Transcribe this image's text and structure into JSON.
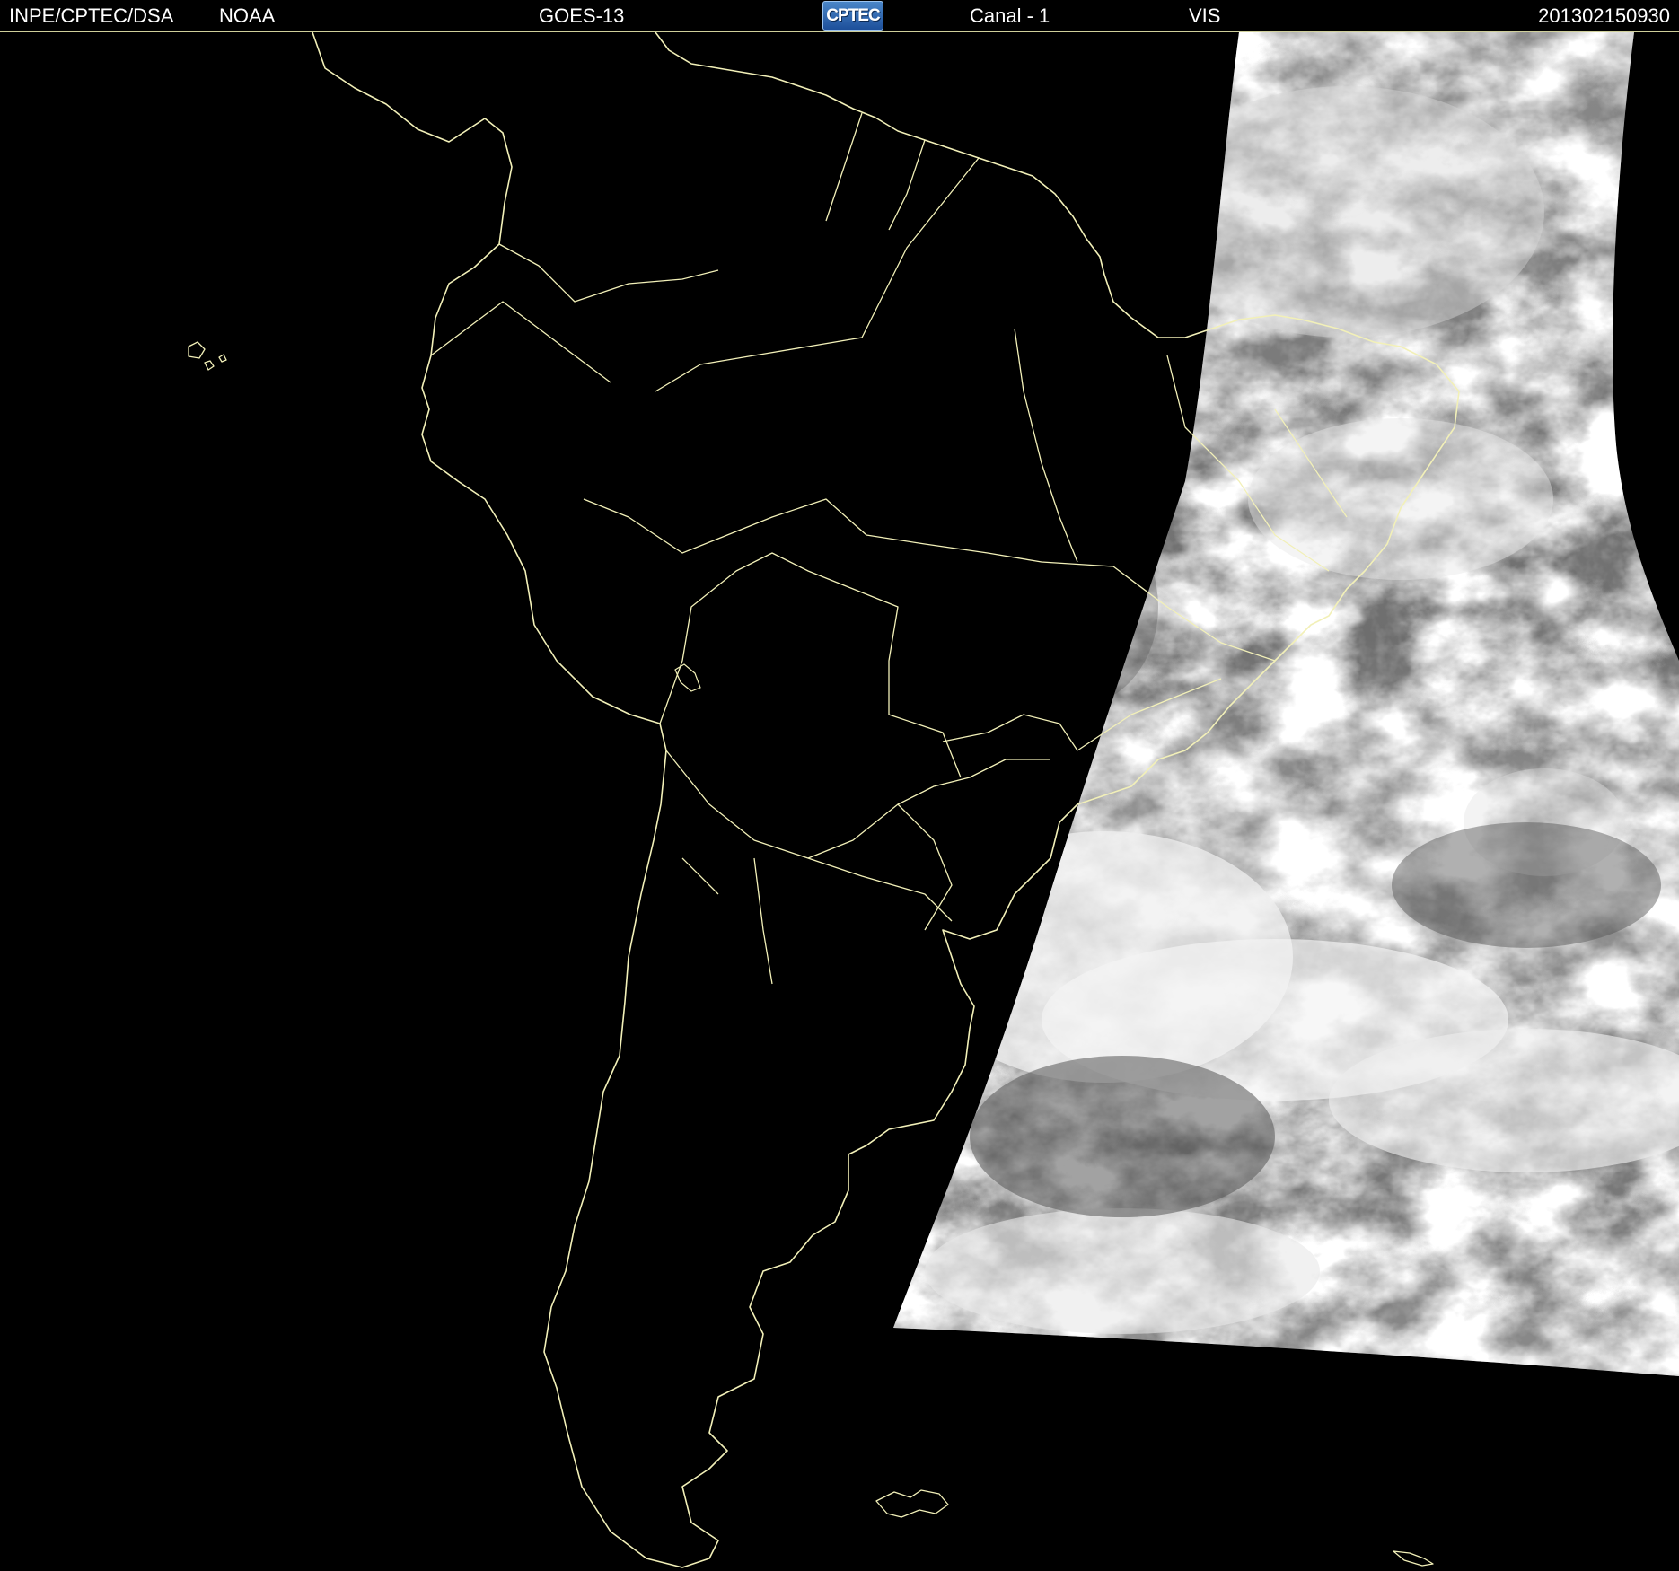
{
  "header": {
    "agency": "INPE/CPTEC/DSA",
    "source": "NOAA",
    "satellite": "GOES-13",
    "logo_text": "CPTEC",
    "channel": "Canal - 1",
    "band": "VIS",
    "timestamp": "201302150930"
  },
  "colors": {
    "background": "#000000",
    "header_text": "#ffffff",
    "coastline": "#f2f0b8",
    "cloud_light": "#f2f2f2",
    "cloud_dark": "#5c5c5c",
    "logo_blue": "#2d66b2"
  },
  "icons": {
    "logo": "cptec-logo"
  }
}
